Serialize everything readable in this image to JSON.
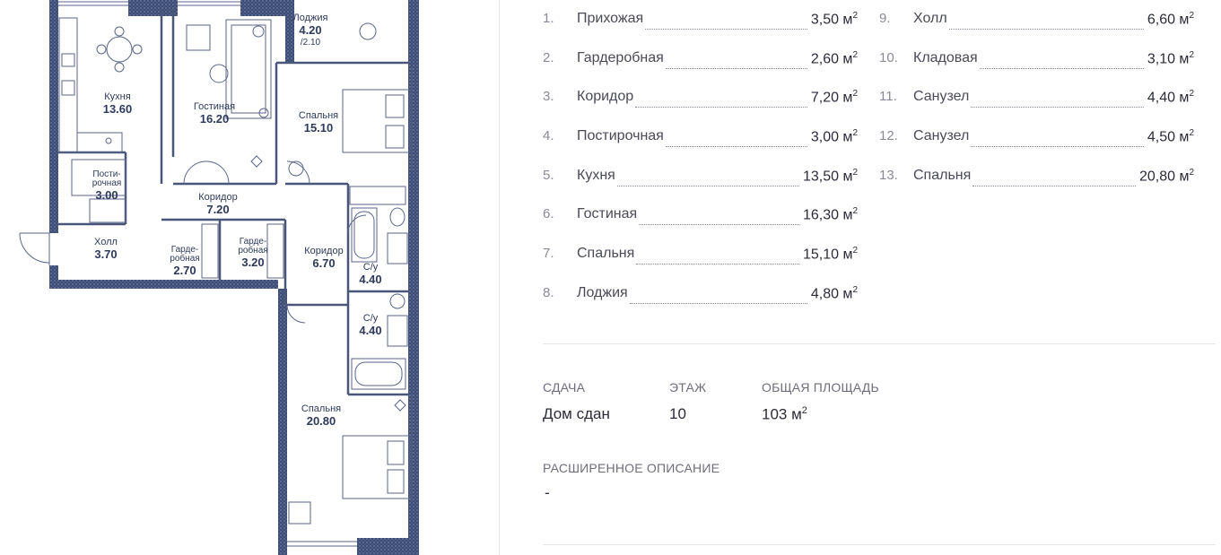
{
  "plan": {
    "colors": {
      "wall": "#3c4c74",
      "line": "#5a6688",
      "bg": "#ffffff"
    },
    "labels": {
      "loggia": {
        "name": "Лоджия",
        "area": "4.20",
        "sub": "/2.10"
      },
      "kitchen": {
        "name": "Кухня",
        "area": "13.60"
      },
      "living": {
        "name": "Гостиная",
        "area": "16.20"
      },
      "bedroom1": {
        "name": "Спальня",
        "area": "15.10"
      },
      "laundry": {
        "name": "Пости-\nрочная",
        "area": "3.00"
      },
      "corridor1": {
        "name": "Коридор",
        "area": "7.20"
      },
      "hall": {
        "name": "Холл",
        "area": "3.70"
      },
      "wardrobe1": {
        "name": "Гарде-\nробная",
        "area": "2.70"
      },
      "wardrobe2": {
        "name": "Гарде-\nробная",
        "area": "3.20"
      },
      "corridor2": {
        "name": "Коридор",
        "area": "6.70"
      },
      "bath1": {
        "name": "С/у",
        "area": "4.40"
      },
      "bath2": {
        "name": "С/у",
        "area": "4.40"
      },
      "bedroom2": {
        "name": "Спальня",
        "area": "20.80"
      }
    }
  },
  "rooms_left": [
    {
      "num": "1.",
      "name": "Прихожая",
      "area": "3,50 м",
      "unit_sup": "2"
    },
    {
      "num": "2.",
      "name": "Гардеробная",
      "area": "2,60 м",
      "unit_sup": "2"
    },
    {
      "num": "3.",
      "name": "Коридор",
      "area": "7,20 м",
      "unit_sup": "2"
    },
    {
      "num": "4.",
      "name": "Постирочная",
      "area": "3,00 м",
      "unit_sup": "2"
    },
    {
      "num": "5.",
      "name": "Кухня",
      "area": "13,50 м",
      "unit_sup": "2"
    },
    {
      "num": "6.",
      "name": "Гостиная",
      "area": "16,30 м",
      "unit_sup": "2"
    },
    {
      "num": "7.",
      "name": "Спальня",
      "area": "15,10 м",
      "unit_sup": "2"
    },
    {
      "num": "8.",
      "name": "Лоджия",
      "area": "4,80 м",
      "unit_sup": "2"
    }
  ],
  "rooms_right": [
    {
      "num": "9.",
      "name": "Холл",
      "area": "6,60 м",
      "unit_sup": "2"
    },
    {
      "num": "10.",
      "name": "Кладовая",
      "area": "3,10 м",
      "unit_sup": "2"
    },
    {
      "num": "11.",
      "name": "Санузел",
      "area": "4,40 м",
      "unit_sup": "2"
    },
    {
      "num": "12.",
      "name": "Санузел",
      "area": "4,50 м",
      "unit_sup": "2"
    },
    {
      "num": "13.",
      "name": "Спальня",
      "area": "20,80 м",
      "unit_sup": "2"
    }
  ],
  "info": {
    "delivery_label": "СДАЧА",
    "delivery_value": "Дом сдан",
    "floor_label": "ЭТАЖ",
    "floor_value": "10",
    "total_label": "ОБЩАЯ ПЛОЩАДЬ",
    "total_value": "103 м",
    "total_sup": "2",
    "extended_label": "РАСШИРЕННОЕ ОПИСАНИЕ",
    "extended_value": "-"
  }
}
